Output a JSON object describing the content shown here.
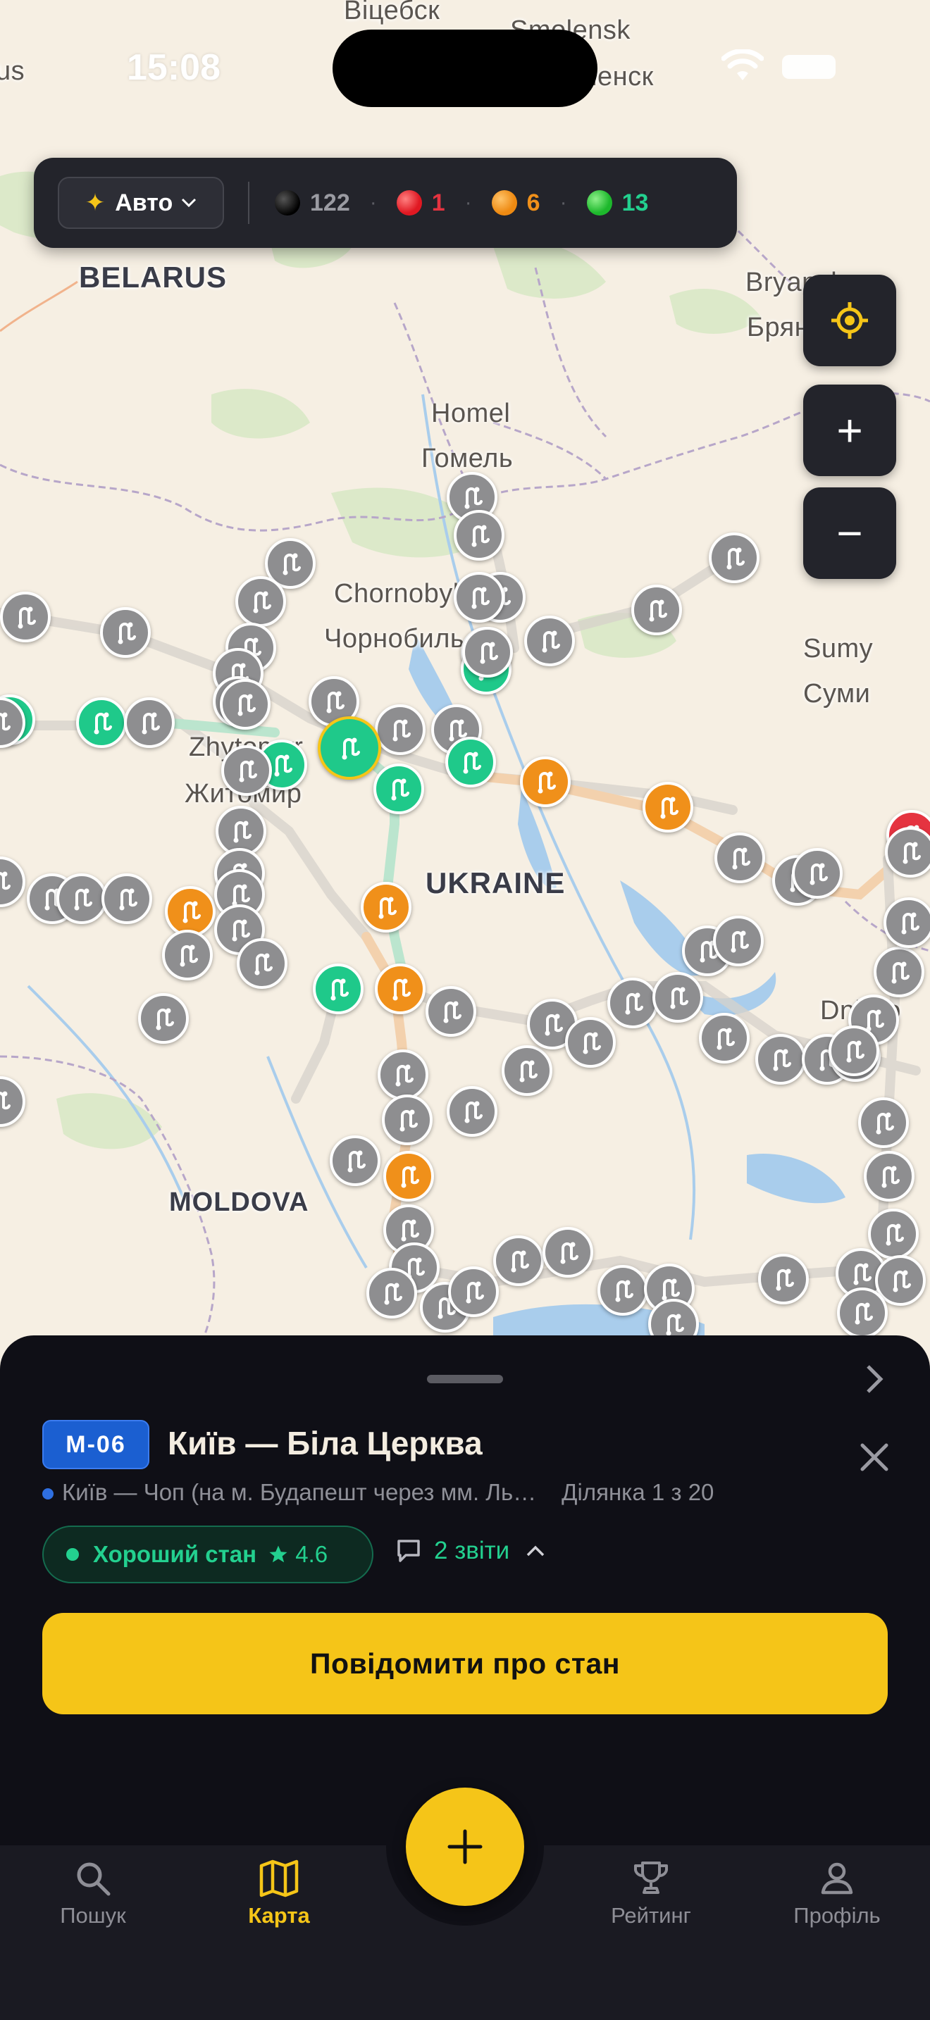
{
  "status_bar": {
    "time": "15:08"
  },
  "map": {
    "labels": {
      "vitebsk": "Віцебск",
      "smolensk": "Smolensk",
      "smolensk_cyr": "Смоленск",
      "belarus": "BELARUS",
      "bryansk": "Bryansk",
      "bryansk_cyr": "Брянск",
      "homel": "Homel",
      "homel_cyr": "Гомель",
      "chornobyl": "Chornobyl",
      "chornobyl_cyr": "Чорнобиль",
      "sumy": "Sumy",
      "sumy_cyr": "Суми",
      "zhytomyr": "Zhytomyr",
      "zhytomyr_cyr": "Житомир",
      "ukraine": "UKRAINE",
      "moldova": "MOLDOVA",
      "dnipro": "Dnipro",
      "us": "us"
    },
    "marker_icon": "road-route-icon"
  },
  "filter_bar": {
    "mode_label": "Авто",
    "mode_icon": "sparkles-icon",
    "counts": [
      {
        "key": "none",
        "value": "122",
        "color": "#9a9ba2"
      },
      {
        "key": "bad",
        "value": "1",
        "color": "#e53340"
      },
      {
        "key": "medium",
        "value": "6",
        "color": "#f0901a"
      },
      {
        "key": "good",
        "value": "13",
        "color": "#23d08f"
      }
    ]
  },
  "map_controls": {
    "locate_icon": "locate-icon",
    "zoom_in": "+",
    "zoom_out": "−"
  },
  "sheet": {
    "road_code": "M-06",
    "road_title": "Київ — Біла Церква",
    "route_name": "Київ — Чоп (на м. Будапешт через мм. Ль…",
    "segment": "Ділянка 1 з 20",
    "state_label": "Хороший стан",
    "rating": "4.6",
    "reports_label": "2 звіти",
    "action_button": "Повідомити про стан"
  },
  "tabbar": {
    "tabs": [
      {
        "label": "Пошук",
        "icon": "search-icon"
      },
      {
        "label": "Карта",
        "icon": "map-icon"
      },
      {
        "label": "Рейтинг",
        "icon": "trophy-icon"
      },
      {
        "label": "Профіль",
        "icon": "profile-icon"
      }
    ],
    "fab_icon": "plus-icon"
  }
}
